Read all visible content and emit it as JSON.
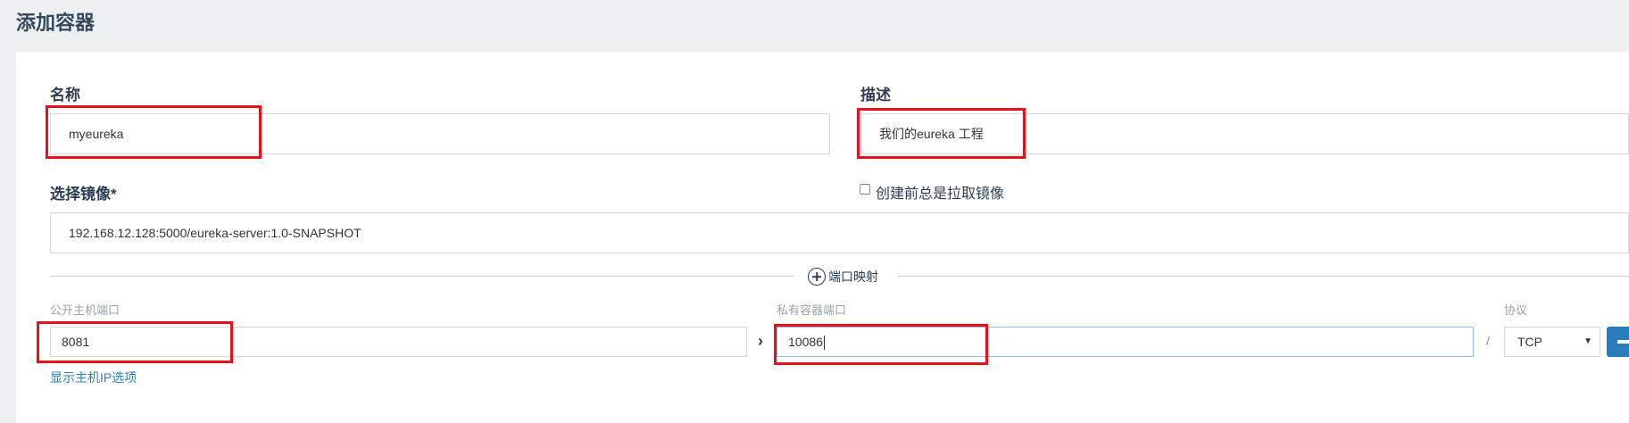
{
  "page": {
    "title": "添加容器"
  },
  "form": {
    "name": {
      "label": "名称",
      "value": "myeureka"
    },
    "description": {
      "label": "描述",
      "value": "我们的eureka 工程"
    },
    "image": {
      "label": "选择镜像*",
      "value": "192.168.12.128:5000/eureka-server:1.0-SNAPSHOT"
    },
    "always_pull": {
      "label": "创建前总是拉取镜像",
      "checked": false
    },
    "port_mapping": {
      "title": "端口映射",
      "public_port_label": "公开主机端口",
      "public_port_value": "8081",
      "private_port_label": "私有容器端口",
      "private_port_value": "10086",
      "separator": "/",
      "protocol_label": "协议",
      "protocol_value": "TCP",
      "show_host_ip_link": "显示主机IP选项"
    }
  },
  "colors": {
    "highlight": "#e8111b",
    "accent": "#2a7dbc",
    "link": "#2980b9"
  },
  "icons": [
    "plus-circle-icon",
    "chevron-right-icon",
    "dropdown-arrow-icon",
    "minus-icon"
  ]
}
